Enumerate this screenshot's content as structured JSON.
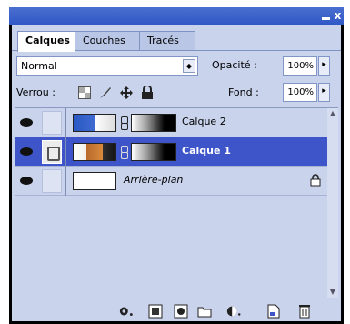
{
  "tabs": [
    {
      "label": "Calques",
      "active": true
    },
    {
      "label": "Couches",
      "active": false
    },
    {
      "label": "Tracés",
      "active": false
    }
  ],
  "blend": {
    "mode": "Normal",
    "opacity_label": "Opacité :",
    "opacity_value": "100%"
  },
  "lock": {
    "label": "Verrou :",
    "fill_label": "Fond :",
    "fill_value": "100%"
  },
  "layers": [
    {
      "name": "Calque 2",
      "selected": false,
      "visible": true
    },
    {
      "name": "Calque 1",
      "selected": true,
      "visible": true
    },
    {
      "name": "Arrière-plan",
      "selected": false,
      "visible": true,
      "locked": true
    }
  ],
  "colors": {
    "selection": "#3d55c9",
    "panel": "#c9d3ec",
    "titlebar": "#2f57c6"
  },
  "icons": {
    "lock_buttons": [
      "lock-transparency-icon",
      "lock-paint-icon",
      "lock-move-icon",
      "lock-all-icon"
    ],
    "bottom_buttons": [
      "link-layers-icon",
      "add-layer-style-icon",
      "add-mask-icon",
      "new-group-icon",
      "new-adjustment-layer-icon",
      "new-layer-icon",
      "delete-layer-icon"
    ]
  }
}
